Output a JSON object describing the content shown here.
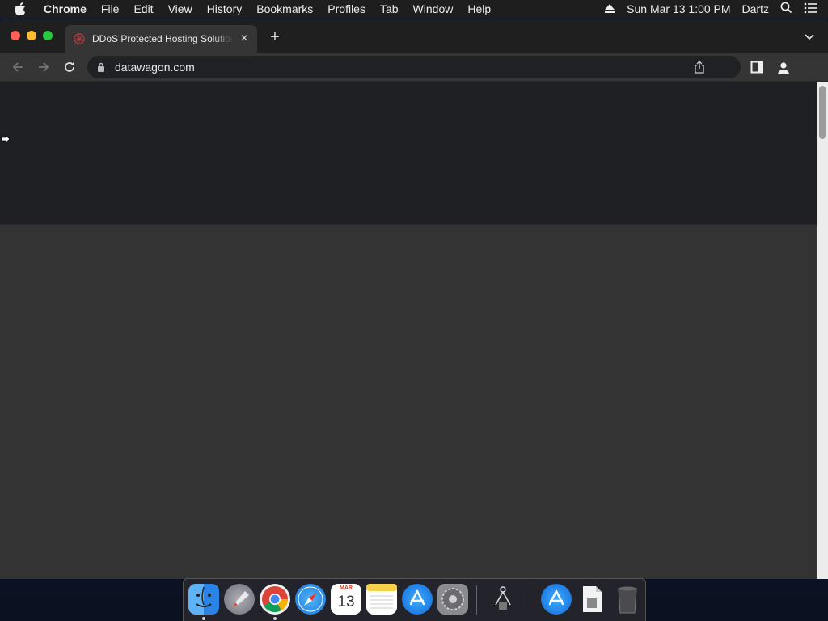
{
  "menubar": {
    "app_name": "Chrome",
    "items": [
      "File",
      "Edit",
      "View",
      "History",
      "Bookmarks",
      "Profiles",
      "Tab",
      "Window",
      "Help"
    ],
    "datetime": "Sun Mar 13  1:00 PM",
    "user": "Dartz"
  },
  "browser": {
    "tab_title": "DDoS Protected Hosting Solutions",
    "url": "datawagon.com"
  },
  "dock": {
    "calendar_month": "MAR",
    "calendar_day": "13",
    "apps": [
      "Finder",
      "Launchpad",
      "Google Chrome",
      "Safari",
      "Calendar",
      "Notes",
      "App Store",
      "System Preferences",
      "Screen Sharing",
      "App Store",
      "Preview",
      "Trash"
    ]
  },
  "colors": {
    "tab_bg": "#353535",
    "titlebar_bg": "#1f1f1f",
    "omnibox_bg": "#202124",
    "page_bg": "#333333",
    "hero_bg": "#1f2023"
  }
}
